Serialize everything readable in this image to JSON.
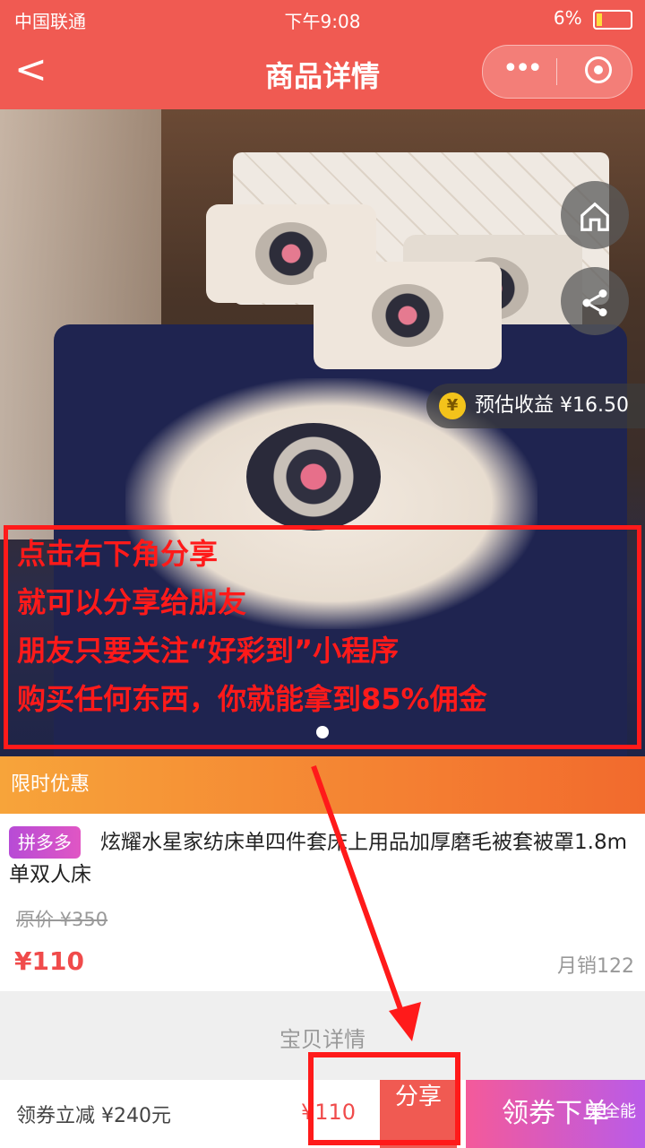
{
  "status_bar": {
    "carrier": "中国联通",
    "time": "下午9:08",
    "battery": "6%"
  },
  "nav": {
    "back_label": "<",
    "title": "商品详情",
    "more_label": "•••",
    "target_icon": "target-icon"
  },
  "hero": {
    "earn_icon_label": "¥",
    "earn_label": "预估收益 ¥16.50",
    "annotation_lines": [
      "点击右下角分享",
      "就可以分享给朋友",
      "朋友只要关注“好彩到”小程序",
      "购买任何东西，你就能拿到85%佣金"
    ]
  },
  "promo": {
    "label": "限时优惠"
  },
  "product": {
    "tag": "拼多多",
    "title": "炫耀水星家纺床单四件套床上用品加厚磨毛被套被罩1.8m单双人床",
    "original_price": "原价 ¥350",
    "price": "¥110",
    "sales": "月销122"
  },
  "detail_section": {
    "title": "宝贝详情"
  },
  "bottom_bar": {
    "coupon": "领券立减 ¥240元",
    "price": "¥110",
    "share_label": "分享",
    "buy_label": "领券下单"
  },
  "watermark": "爱全能"
}
